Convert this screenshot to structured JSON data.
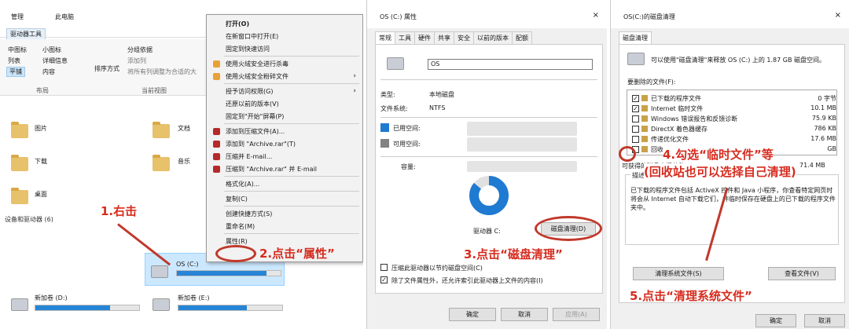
{
  "explorer": {
    "tab_manage": "管理",
    "window_title": "此电脑",
    "tab_drive_tools": "驱动器工具",
    "ribbon": {
      "layout_items": [
        "中图标",
        "小图标",
        "列表",
        "详细信息",
        "平铺",
        "内容"
      ],
      "sort_by": "排序方式",
      "group_by": "分组依据",
      "add_column": "添加列",
      "fit_columns": "将所有列调整为合适的大",
      "group_layout": "布局",
      "group_current_view": "当前视图"
    },
    "folders": [
      {
        "name": "图片"
      },
      {
        "name": "文档"
      },
      {
        "name": "下载"
      },
      {
        "name": "音乐"
      },
      {
        "name": "桌面"
      }
    ],
    "devices_header": "设备和驱动器 (6)",
    "drives": [
      {
        "name": "OS (C:)",
        "fill": 0.86
      },
      {
        "name": "新加卷 (D:)",
        "fill": 0.72
      },
      {
        "name": "新加卷 (E:)",
        "fill": 0.66
      }
    ]
  },
  "context_menu": {
    "items": [
      {
        "label": "打开(O)",
        "bold": true
      },
      {
        "label": "在新窗口中打开(E)"
      },
      {
        "label": "固定到快速访问"
      },
      {
        "label": "使用火绒安全进行杀毒",
        "icon_color": "#e8a23a"
      },
      {
        "label": "使用火绒安全粉碎文件",
        "icon_color": "#e8a23a",
        "submenu": true
      },
      {
        "label": "授予访问权限(G)",
        "submenu": true
      },
      {
        "label": "还原以前的版本(V)"
      },
      {
        "label": "固定到\"开始\"屏幕(P)"
      },
      {
        "label": "添加到压缩文件(A)...",
        "icon_color": "#b52a2a"
      },
      {
        "label": "添加到 \"Archive.rar\"(T)",
        "icon_color": "#b52a2a"
      },
      {
        "label": "压缩并 E-mail...",
        "icon_color": "#b52a2a"
      },
      {
        "label": "压缩到 \"Archive.rar\" 并 E-mail",
        "icon_color": "#b52a2a"
      },
      {
        "label": "格式化(A)..."
      },
      {
        "label": "复制(C)"
      },
      {
        "label": "创建快捷方式(S)"
      },
      {
        "label": "重命名(M)"
      },
      {
        "label": "属性(R)"
      }
    ]
  },
  "properties": {
    "title": "OS (C:) 属性",
    "close": "×",
    "tabs": [
      "常规",
      "工具",
      "硬件",
      "共享",
      "安全",
      "以前的版本",
      "配额"
    ],
    "name_value": "OS",
    "type_label": "类型:",
    "type_value": "本地磁盘",
    "fs_label": "文件系统:",
    "fs_value": "NTFS",
    "used_label": "已用空间:",
    "free_label": "可用空间:",
    "capacity_label": "容量:",
    "drive_label": "驱动器 C:",
    "cleanup_button": "磁盘清理(D)",
    "compress_checkbox": "压缩此驱动器以节约磁盘空间(C)",
    "index_checkbox": "除了文件属性外，还允许索引此驱动器上文件的内容(I)",
    "ok": "确定",
    "cancel": "取消",
    "apply": "应用(A)",
    "used_color": "#1f7ad2",
    "free_color": "#828282",
    "used_fraction": 0.86
  },
  "cleanup": {
    "title": "OS(C:)的磁盘清理",
    "close": "×",
    "tab": "磁盘清理",
    "intro": "可以使用\"磁盘清理\"来释放 OS (C:) 上的 1.87 GB 磁盘空间。",
    "files_to_delete_label": "要删除的文件(F):",
    "items": [
      {
        "name": "已下载的程序文件",
        "size": "0 字节",
        "checked": true
      },
      {
        "name": "Internet 临时文件",
        "size": "10.1 MB",
        "checked": true
      },
      {
        "name": "Windows 错误报告和反馈诊断",
        "size": "75.9 KB",
        "checked": false
      },
      {
        "name": "DirectX 着色器缓存",
        "size": "786 KB",
        "checked": false
      },
      {
        "name": "传递优化文件",
        "size": "17.6 MB",
        "checked": false
      },
      {
        "name": "回收站",
        "size": "GB",
        "checked": false
      }
    ],
    "obtainable_label": "可获得的磁盘空间总数:",
    "obtainable_value": "71.4 MB",
    "desc_label": "描述",
    "description": "已下载的程序文件包括 ActiveX 控件和 Java 小程序，你查看特定网页时将会从 Internet 自动下载它们，并临时保存在硬盘上的已下载的程序文件夹中。",
    "clean_system_button": "清理系统文件(S)",
    "view_files_button": "查看文件(V)",
    "ok": "确定",
    "cancel": "取消"
  },
  "annotations": {
    "step1": "1.右击",
    "step2": "2.点击“属性”",
    "step3": "3.点击“磁盘清理”",
    "step4a": "4.勾选“临时文件”等",
    "step4b": "(回收站也可以选择自己清理)",
    "step5": "5.点击“清理系统文件”"
  }
}
